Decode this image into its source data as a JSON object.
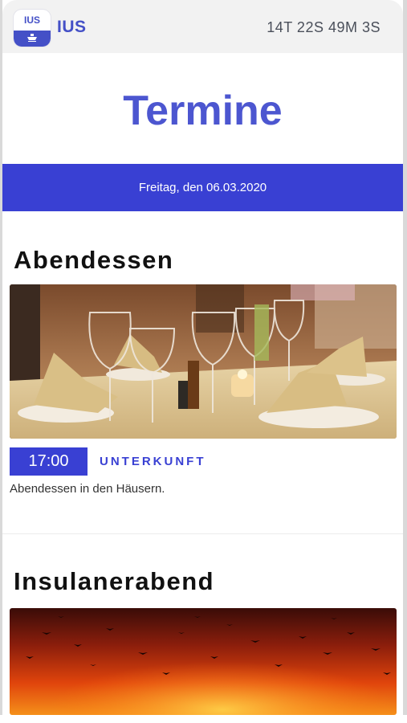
{
  "header": {
    "logo_text": "IUS",
    "app_title": "IUS",
    "countdown": "14T 22S 49M 3S"
  },
  "page": {
    "title": "Termine",
    "date_label": "Freitag, den 06.03.2020"
  },
  "events": [
    {
      "title": "Abendessen",
      "photo_icon": "dinner-table-photo",
      "time": "17:00",
      "location": "UNTERKUNFT",
      "description": "Abendessen in den Häusern."
    },
    {
      "title": "Insulanerabend",
      "photo_icon": "sunset-birds-photo"
    }
  ],
  "colors": {
    "accent": "#3940d3",
    "title": "#4c56d0",
    "header_bg": "#f2f2f2"
  }
}
